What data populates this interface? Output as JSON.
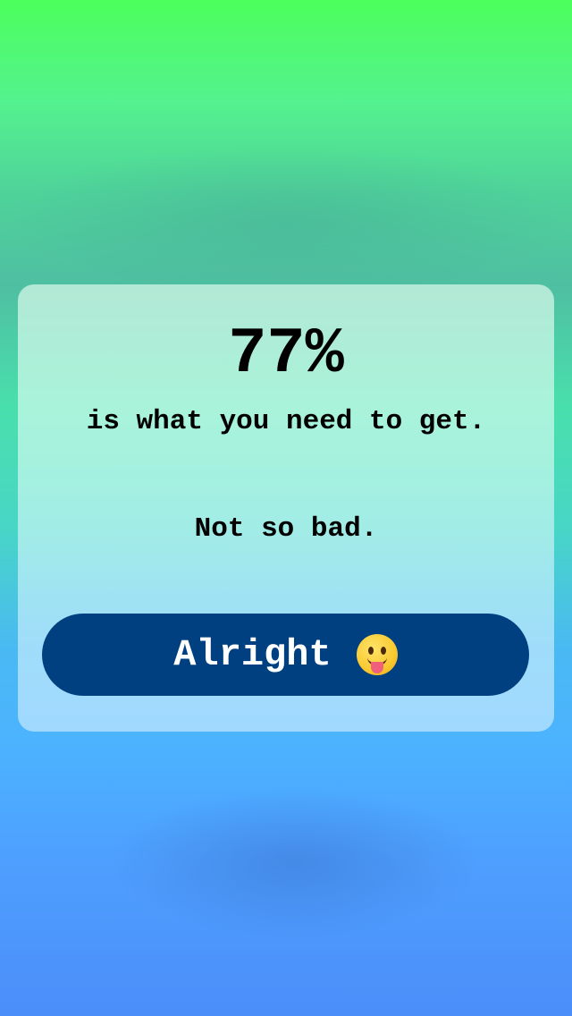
{
  "result": {
    "percent": "77%",
    "message": "is what you need to get.",
    "verdict": "Not so bad."
  },
  "action": {
    "label": "Alright",
    "emoji_icon": "face-with-tongue-icon"
  },
  "colors": {
    "button": "#004080",
    "gradient_top": "#4cff5c",
    "gradient_bottom": "#4b8ef9"
  }
}
